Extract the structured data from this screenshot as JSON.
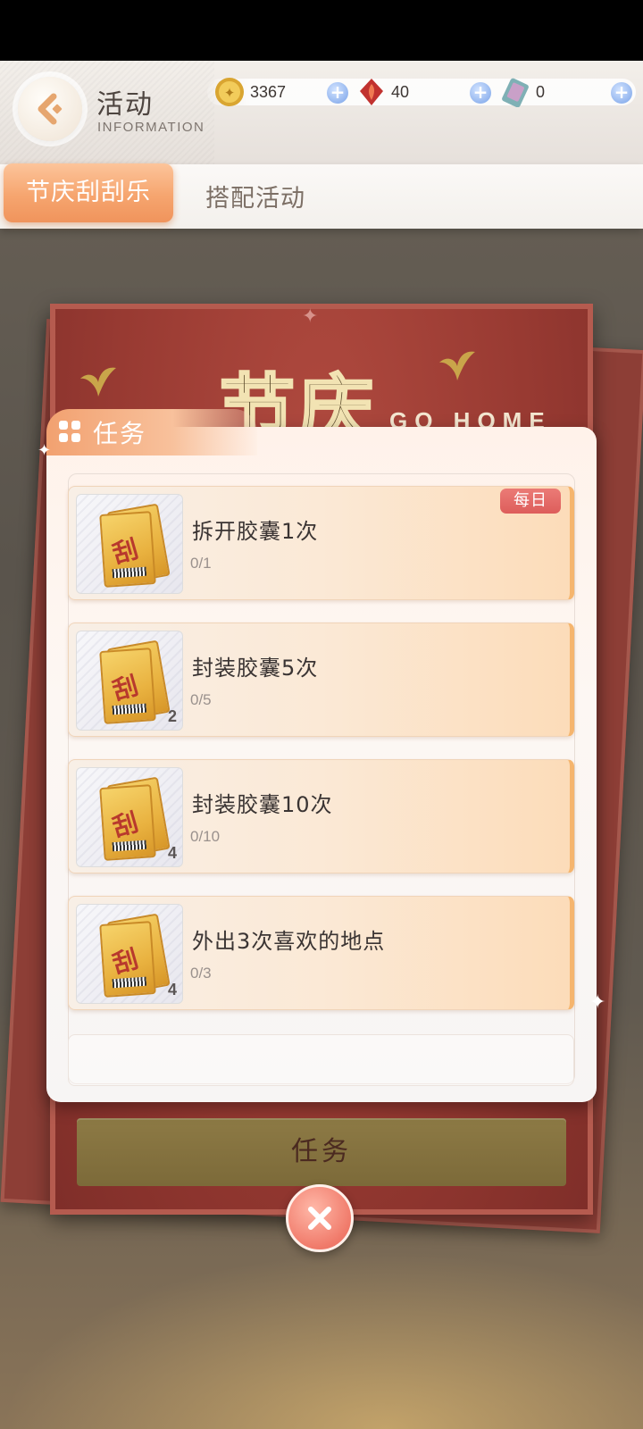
{
  "header": {
    "title": "活动",
    "subtitle": "INFORMATION"
  },
  "currencies": [
    {
      "icon": "gold-coin-icon",
      "value": "3367"
    },
    {
      "icon": "red-gem-icon",
      "value": "40"
    },
    {
      "icon": "ticket-card-icon",
      "value": "0"
    }
  ],
  "tabs": {
    "active": "节庆刮刮乐",
    "other": "搭配活动"
  },
  "poster": {
    "title": "节庆",
    "en": "GO HOME"
  },
  "panel": {
    "title": "任务",
    "daily_badge": "每日",
    "tasks": [
      {
        "name": "拆开胶囊1次",
        "progress": "0/1",
        "count": ""
      },
      {
        "name": "封装胶囊5次",
        "progress": "0/5",
        "count": "2"
      },
      {
        "name": "封装胶囊10次",
        "progress": "0/10",
        "count": "4"
      },
      {
        "name": "外出3次喜欢的地点",
        "progress": "0/3",
        "count": "4"
      }
    ]
  },
  "bottom": {
    "button_label": "任务"
  },
  "colors": {
    "accent_orange": "#f6a56f",
    "badge_red": "#dd5d5b",
    "poster_red": "#983a32"
  }
}
